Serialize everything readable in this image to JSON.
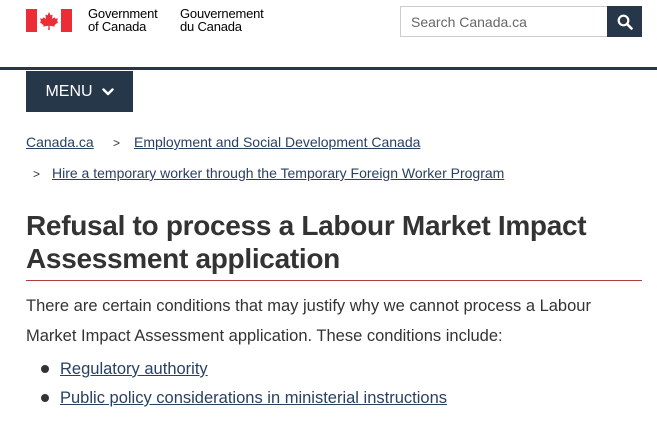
{
  "header": {
    "gov_en_line1": "Government",
    "gov_en_line2": "of Canada",
    "gov_fr_line1": "Gouvernement",
    "gov_fr_line2": "du Canada",
    "search_placeholder": "Search Canada.ca",
    "flag_icon": "canada-flag-icon",
    "search_icon": "search-icon"
  },
  "menu": {
    "label": "MENU",
    "icon": "chevron-down-icon"
  },
  "breadcrumb": {
    "items": [
      {
        "label": "Canada.ca"
      },
      {
        "label": "Employment and Social Development Canada"
      },
      {
        "label": "Hire a temporary worker through the Temporary Foreign Worker Program"
      }
    ]
  },
  "page": {
    "title": "Refusal to process a Labour Market Impact Assessment application",
    "intro": "There are certain conditions that may justify why we cannot process a Labour Market Impact Assessment application. These conditions include:",
    "links": [
      {
        "label": "Regulatory authority"
      },
      {
        "label": "Public policy considerations in ministerial instructions"
      }
    ]
  },
  "colors": {
    "brand_navy": "#26374a",
    "flag_red": "#eb2d37",
    "title_rule": "#af3c43",
    "link": "#284162"
  }
}
